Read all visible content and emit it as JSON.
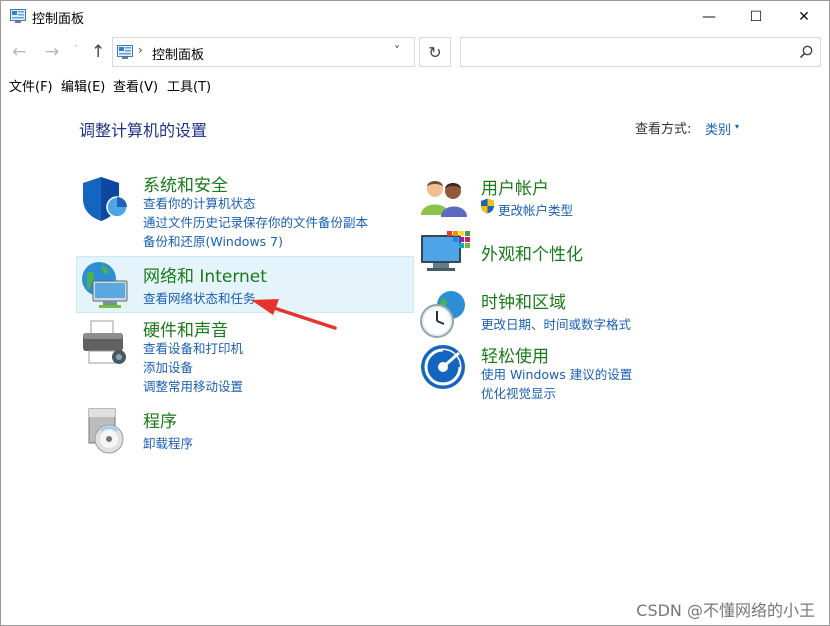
{
  "window": {
    "title": "控制面板",
    "title_icon": "control-panel-icon",
    "min_symbol": "—",
    "max_symbol": "☐",
    "close_symbol": "✕"
  },
  "nav": {
    "back_symbol": "←",
    "forward_symbol": "→",
    "recent_symbol": "˅",
    "up_symbol": "↑",
    "breadcrumb": "控制面板",
    "breadcrumb_sep": "›",
    "dropdown_symbol": "˅",
    "refresh_symbol": "↻",
    "search_placeholder": ""
  },
  "menu": {
    "items": [
      "文件(F)",
      "编辑(E)",
      "查看(V)",
      "工具(T)"
    ]
  },
  "content": {
    "page_title": "调整计算机的设置",
    "view_by_label": "查看方式:",
    "view_by_value": "类别",
    "view_by_caret": "▾"
  },
  "categories": {
    "system": {
      "title": "系统和安全",
      "icon": "shield-icon",
      "links": [
        "查看你的计算机状态",
        "通过文件历史记录保存你的文件备份副本",
        "备份和还原(Windows 7)"
      ]
    },
    "network": {
      "title": "网络和 Internet",
      "icon": "network-globe-icon",
      "links": [
        "查看网络状态和任务"
      ]
    },
    "hardware": {
      "title": "硬件和声音",
      "icon": "printer-icon",
      "links": [
        "查看设备和打印机",
        "添加设备",
        "调整常用移动设置"
      ]
    },
    "programs": {
      "title": "程序",
      "icon": "programs-disc-icon",
      "links": [
        "卸载程序"
      ]
    },
    "users": {
      "title": "用户帐户",
      "icon": "users-icon",
      "links": [
        "更改帐户类型"
      ]
    },
    "appearance": {
      "title": "外观和个性化",
      "icon": "monitor-palette-icon",
      "links": []
    },
    "clock": {
      "title": "时钟和区域",
      "icon": "clock-globe-icon",
      "links": [
        "更改日期、时间或数字格式"
      ]
    },
    "ease": {
      "title": "轻松使用",
      "icon": "ease-of-access-icon",
      "links": [
        "使用 Windows 建议的设置",
        "优化视觉显示"
      ]
    }
  },
  "colors": {
    "title_blue": "#1e3287",
    "link_blue": "#1a5fb4",
    "category_green": "#1a7a1a",
    "highlight": "#e5f3fb",
    "annotation_red": "#e8332c"
  },
  "watermark": "CSDN @不懂网络的小王"
}
